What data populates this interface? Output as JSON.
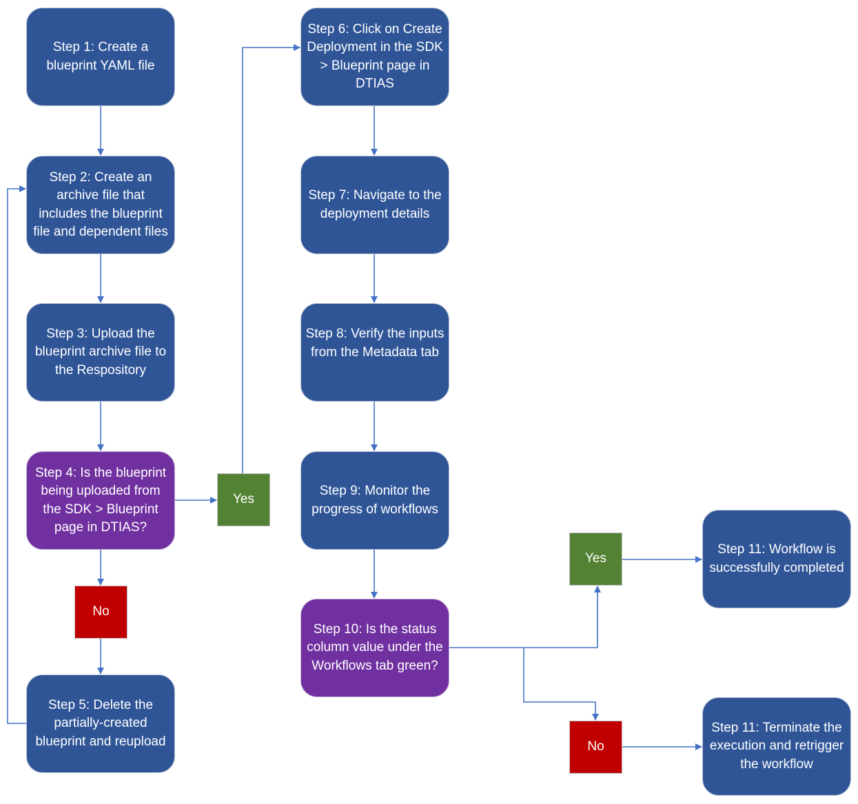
{
  "diagram": {
    "type": "flowchart",
    "colors": {
      "process": "#2f5597",
      "decision": "#7030a0",
      "yes": "#548235",
      "no": "#c00000",
      "connector": "#4472c4"
    },
    "nodes": {
      "step1": "Step 1: Create a blueprint YAML file",
      "step2": "Step 2: Create an archive file that includes the blueprint file and dependent files",
      "step3": "Step 3: Upload the blueprint archive file to the Respository",
      "step4": "Step 4: Is the blueprint being uploaded from the SDK > Blueprint page in DTIAS?",
      "step5": "Step 5: Delete the partially-created blueprint and reupload",
      "step6": "Step 6: Click on Create Deployment in the SDK > Blueprint page in DTIAS",
      "step7": "Step 7: Navigate to the deployment details",
      "step8": "Step 8: Verify the inputs from the Metadata tab",
      "step9": "Step 9: Monitor the progress of workflows",
      "step10": "Step 10: Is the status column value under the Workflows tab green?",
      "step11_success": "Step 11: Workflow is successfully completed",
      "step11_fail": "Step 11: Terminate the execution and retrigger the workflow",
      "yes1": "Yes",
      "no1": "No",
      "yes2": "Yes",
      "no2": "No"
    },
    "edges": [
      {
        "from": "step1",
        "to": "step2"
      },
      {
        "from": "step2",
        "to": "step3"
      },
      {
        "from": "step3",
        "to": "step4"
      },
      {
        "from": "step4",
        "to": "yes1"
      },
      {
        "from": "step4",
        "to": "no1"
      },
      {
        "from": "yes1",
        "to": "step6"
      },
      {
        "from": "no1",
        "to": "step5"
      },
      {
        "from": "step5",
        "to": "step2"
      },
      {
        "from": "step6",
        "to": "step7"
      },
      {
        "from": "step7",
        "to": "step8"
      },
      {
        "from": "step8",
        "to": "step9"
      },
      {
        "from": "step9",
        "to": "step10"
      },
      {
        "from": "step10",
        "to": "yes2"
      },
      {
        "from": "step10",
        "to": "no2"
      },
      {
        "from": "yes2",
        "to": "step11_success"
      },
      {
        "from": "no2",
        "to": "step11_fail"
      }
    ]
  }
}
